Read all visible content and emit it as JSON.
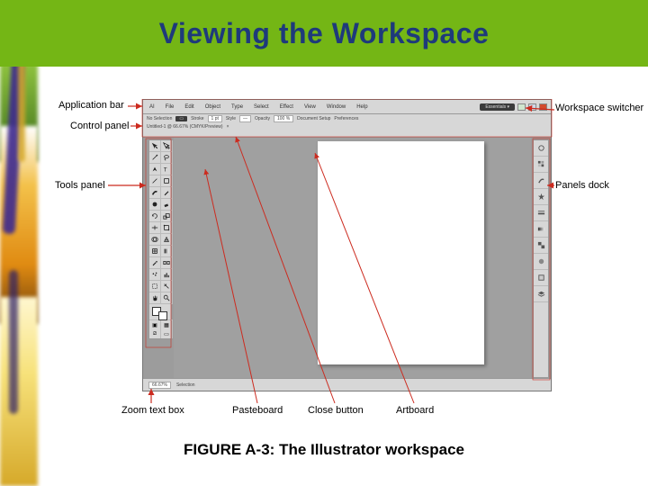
{
  "title": "Viewing the Workspace",
  "caption": "FIGURE A-3: The Illustrator workspace",
  "annotations": {
    "application_bar": "Application bar",
    "control_panel": "Control panel",
    "tools_panel": "Tools panel",
    "zoom_text_box": "Zoom text box",
    "pasteboard": "Pasteboard",
    "close_button": "Close button",
    "artboard": "Artboard",
    "workspace_switcher": "Workspace switcher",
    "panels_dock": "Panels dock"
  },
  "app": {
    "menu": [
      "AI",
      "File",
      "Edit",
      "Object",
      "Type",
      "Select",
      "Effect",
      "View",
      "Window",
      "Help"
    ],
    "workspace_switcher_label": "Essentials ▾",
    "control_row1": {
      "label": "No Selection",
      "stroke": "Stroke",
      "stroke_val": "1 pt",
      "style": "Style",
      "opacity": "Opacity",
      "opacity_val": "100 %",
      "doc": "Document Setup",
      "pref": "Preferences"
    },
    "control_row2": {
      "doc_tab": "Untitled-1 @ 66.67% (CMYK/Preview)"
    },
    "status": {
      "zoom": "66.67%",
      "tool": "Selection"
    }
  },
  "colors": {
    "title_band": "#74b615",
    "title_text": "#1e3a7b",
    "arrow": "#cc2b1f"
  }
}
